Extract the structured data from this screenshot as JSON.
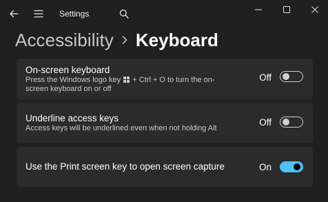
{
  "titlebar": {
    "title": "Settings",
    "back_icon": "arrow-left-icon",
    "menu_icon": "hamburger-menu-icon",
    "search_icon": "search-icon"
  },
  "window_controls": {
    "minimize_icon": "minimize-icon",
    "maximize_icon": "maximize-icon",
    "close_icon": "close-icon"
  },
  "breadcrumb": {
    "parent": "Accessibility",
    "separator_icon": "chevron-right-icon",
    "current": "Keyboard"
  },
  "settings": [
    {
      "title": "On-screen keyboard",
      "description_before": "Press the Windows logo key",
      "description_after": "+ Ctrl + O to turn the on-screen keyboard on or off",
      "description_icon": "windows-logo-icon",
      "state_label": "Off",
      "enabled": false
    },
    {
      "title": "Underline access keys",
      "description": "Access keys will be underlined even when not holding Alt",
      "state_label": "Off",
      "enabled": false
    },
    {
      "title": "Use the Print screen key to open screen capture",
      "state_label": "On",
      "enabled": true
    }
  ],
  "colors": {
    "background": "#202020",
    "card": "#2b2b2b",
    "accent": "#4cc2ff"
  }
}
